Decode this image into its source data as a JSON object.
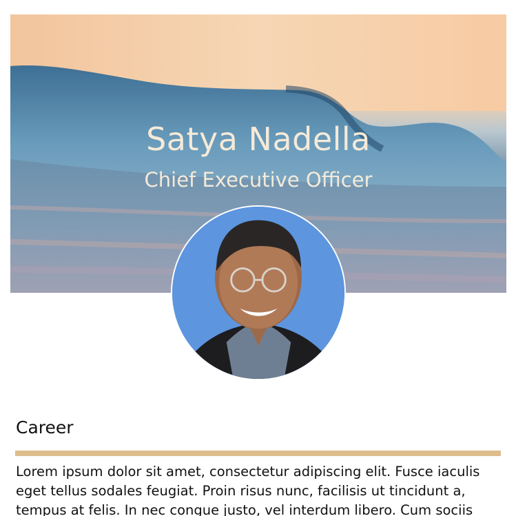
{
  "profile": {
    "name": "Satya Nadella",
    "title": "Chief Executive Officer",
    "avatar_icon": "portrait-photo"
  },
  "career": {
    "heading": "Career",
    "divider_color": "#ddbd8b",
    "paragraph": "Lorem ipsum dolor sit amet, consectetur adipiscing elit. Fusce iaculis eget tellus sodales feugiat. Proin risus nunc, facilisis ut tincidunt a, tempus at felis. In nec congue justo, vel interdum libero. Cum sociis natoque penatibus"
  }
}
